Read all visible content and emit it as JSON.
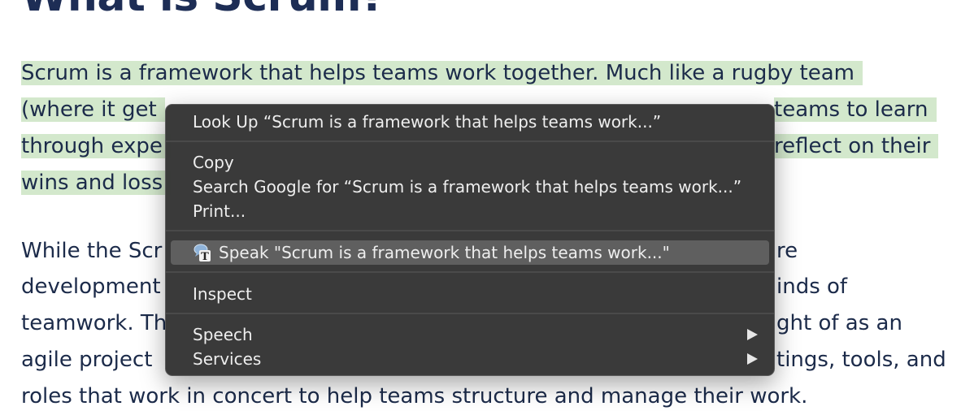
{
  "page": {
    "heading": "What is Scrum?",
    "para1": {
      "line1": "Scrum is a framework that helps teams work together. Much like a rugby team",
      "line2_left": "(where it get",
      "line2_right": "teams to learn",
      "line3_left": "through expe",
      "line3_right": "reflect on their",
      "line4_left": "wins and loss"
    },
    "para2": {
      "line1_left": "While the Scr",
      "line1_right": "re",
      "line2_left": "development",
      "line2_right": "inds of",
      "line3_left": "teamwork. Th",
      "line3_right": "ght of as an",
      "line4_left": "agile project",
      "line4_right": "tings, tools, and",
      "line5": "roles that work in concert to help teams structure and manage their work."
    }
  },
  "context_menu": {
    "look_up": "Look Up “Scrum is a framework that helps teams work...”",
    "copy": "Copy",
    "search_google": "Search Google for “Scrum is a framework that helps teams work...”",
    "print": "Print...",
    "speak": "Speak \"Scrum is a framework that helps teams work...\"",
    "inspect": "Inspect",
    "speech": "Speech",
    "services": "Services"
  },
  "colors": {
    "highlight": "#d3e8cc",
    "menu_bg": "#343434",
    "menu_hover": "#5f5f5f",
    "text": "#1c2b4a"
  }
}
